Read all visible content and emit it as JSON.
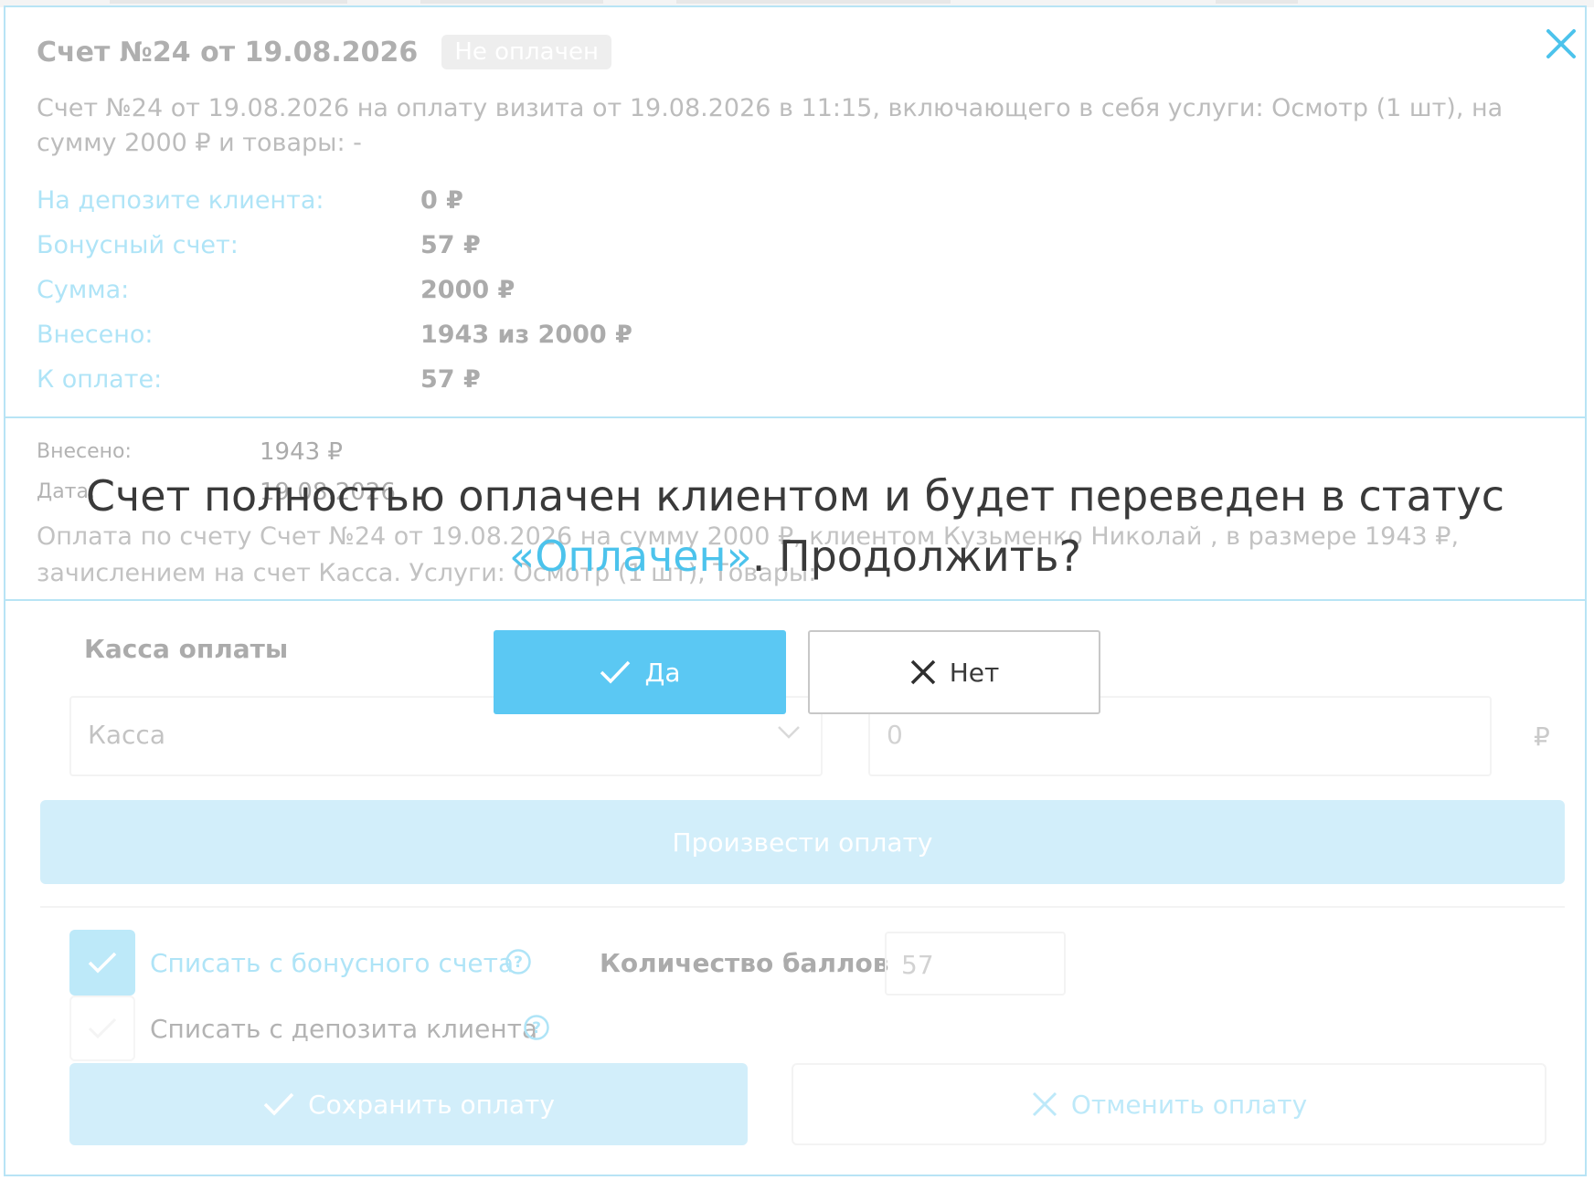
{
  "invoice": {
    "title": "Счет №24 от 19.08.2026",
    "status": "Не оплачен",
    "description": "Счет №24 от 19.08.2026 на оплату визита от 19.08.2026 в 11:15, включающего в себя услуги: Осмотр (1 шт), на сумму 2000 ₽ и товары: -",
    "rows": [
      {
        "label": "На депозите клиента:",
        "value": "0 ₽"
      },
      {
        "label": "Бонусный счет:",
        "value": "57 ₽"
      },
      {
        "label": "Сумма:",
        "value": "2000 ₽"
      },
      {
        "label": "Внесено:",
        "value": "1943 из 2000 ₽"
      },
      {
        "label": "К оплате:",
        "value": "57 ₽"
      }
    ]
  },
  "payment": {
    "paid_label": "Внесено:",
    "paid_value": "1943 ₽",
    "date_label": "Дата:",
    "date_value": "19.08.2026",
    "description": "Оплата по счету Счет №24 от 19.08.2026 на сумму 2000 ₽, клиентом Кузьменко Николай , в размере 1943 ₽, зачислением на счет Касса. Услуги: Осмотр (1 шт), Товары:"
  },
  "form": {
    "cash_heading": "Касса оплаты",
    "cash_select_value": "Касса",
    "amount_value": "0",
    "currency": "₽",
    "pay_button": "Произвести оплату",
    "bonus_checkbox_label": "Списать с бонусного счета",
    "bonus_checked": true,
    "deposit_checkbox_label": "Списать с депозита клиента",
    "deposit_checked": false,
    "points_label": "Количество баллов",
    "points_value": "57",
    "save_button": "Сохранить оплату",
    "cancel_button": "Отменить оплату"
  },
  "confirm": {
    "question_before": "Счет полностью оплачен клиентом и будет переведен в статус ",
    "question_highlight": "«Оплачен»",
    "question_after": ". Продолжить?",
    "yes_label": "Да",
    "no_label": "Нет"
  },
  "colors": {
    "accent": "#4cc3ec",
    "yes_button": "#5bc8f3",
    "faded_button": "#9bd9f4"
  }
}
